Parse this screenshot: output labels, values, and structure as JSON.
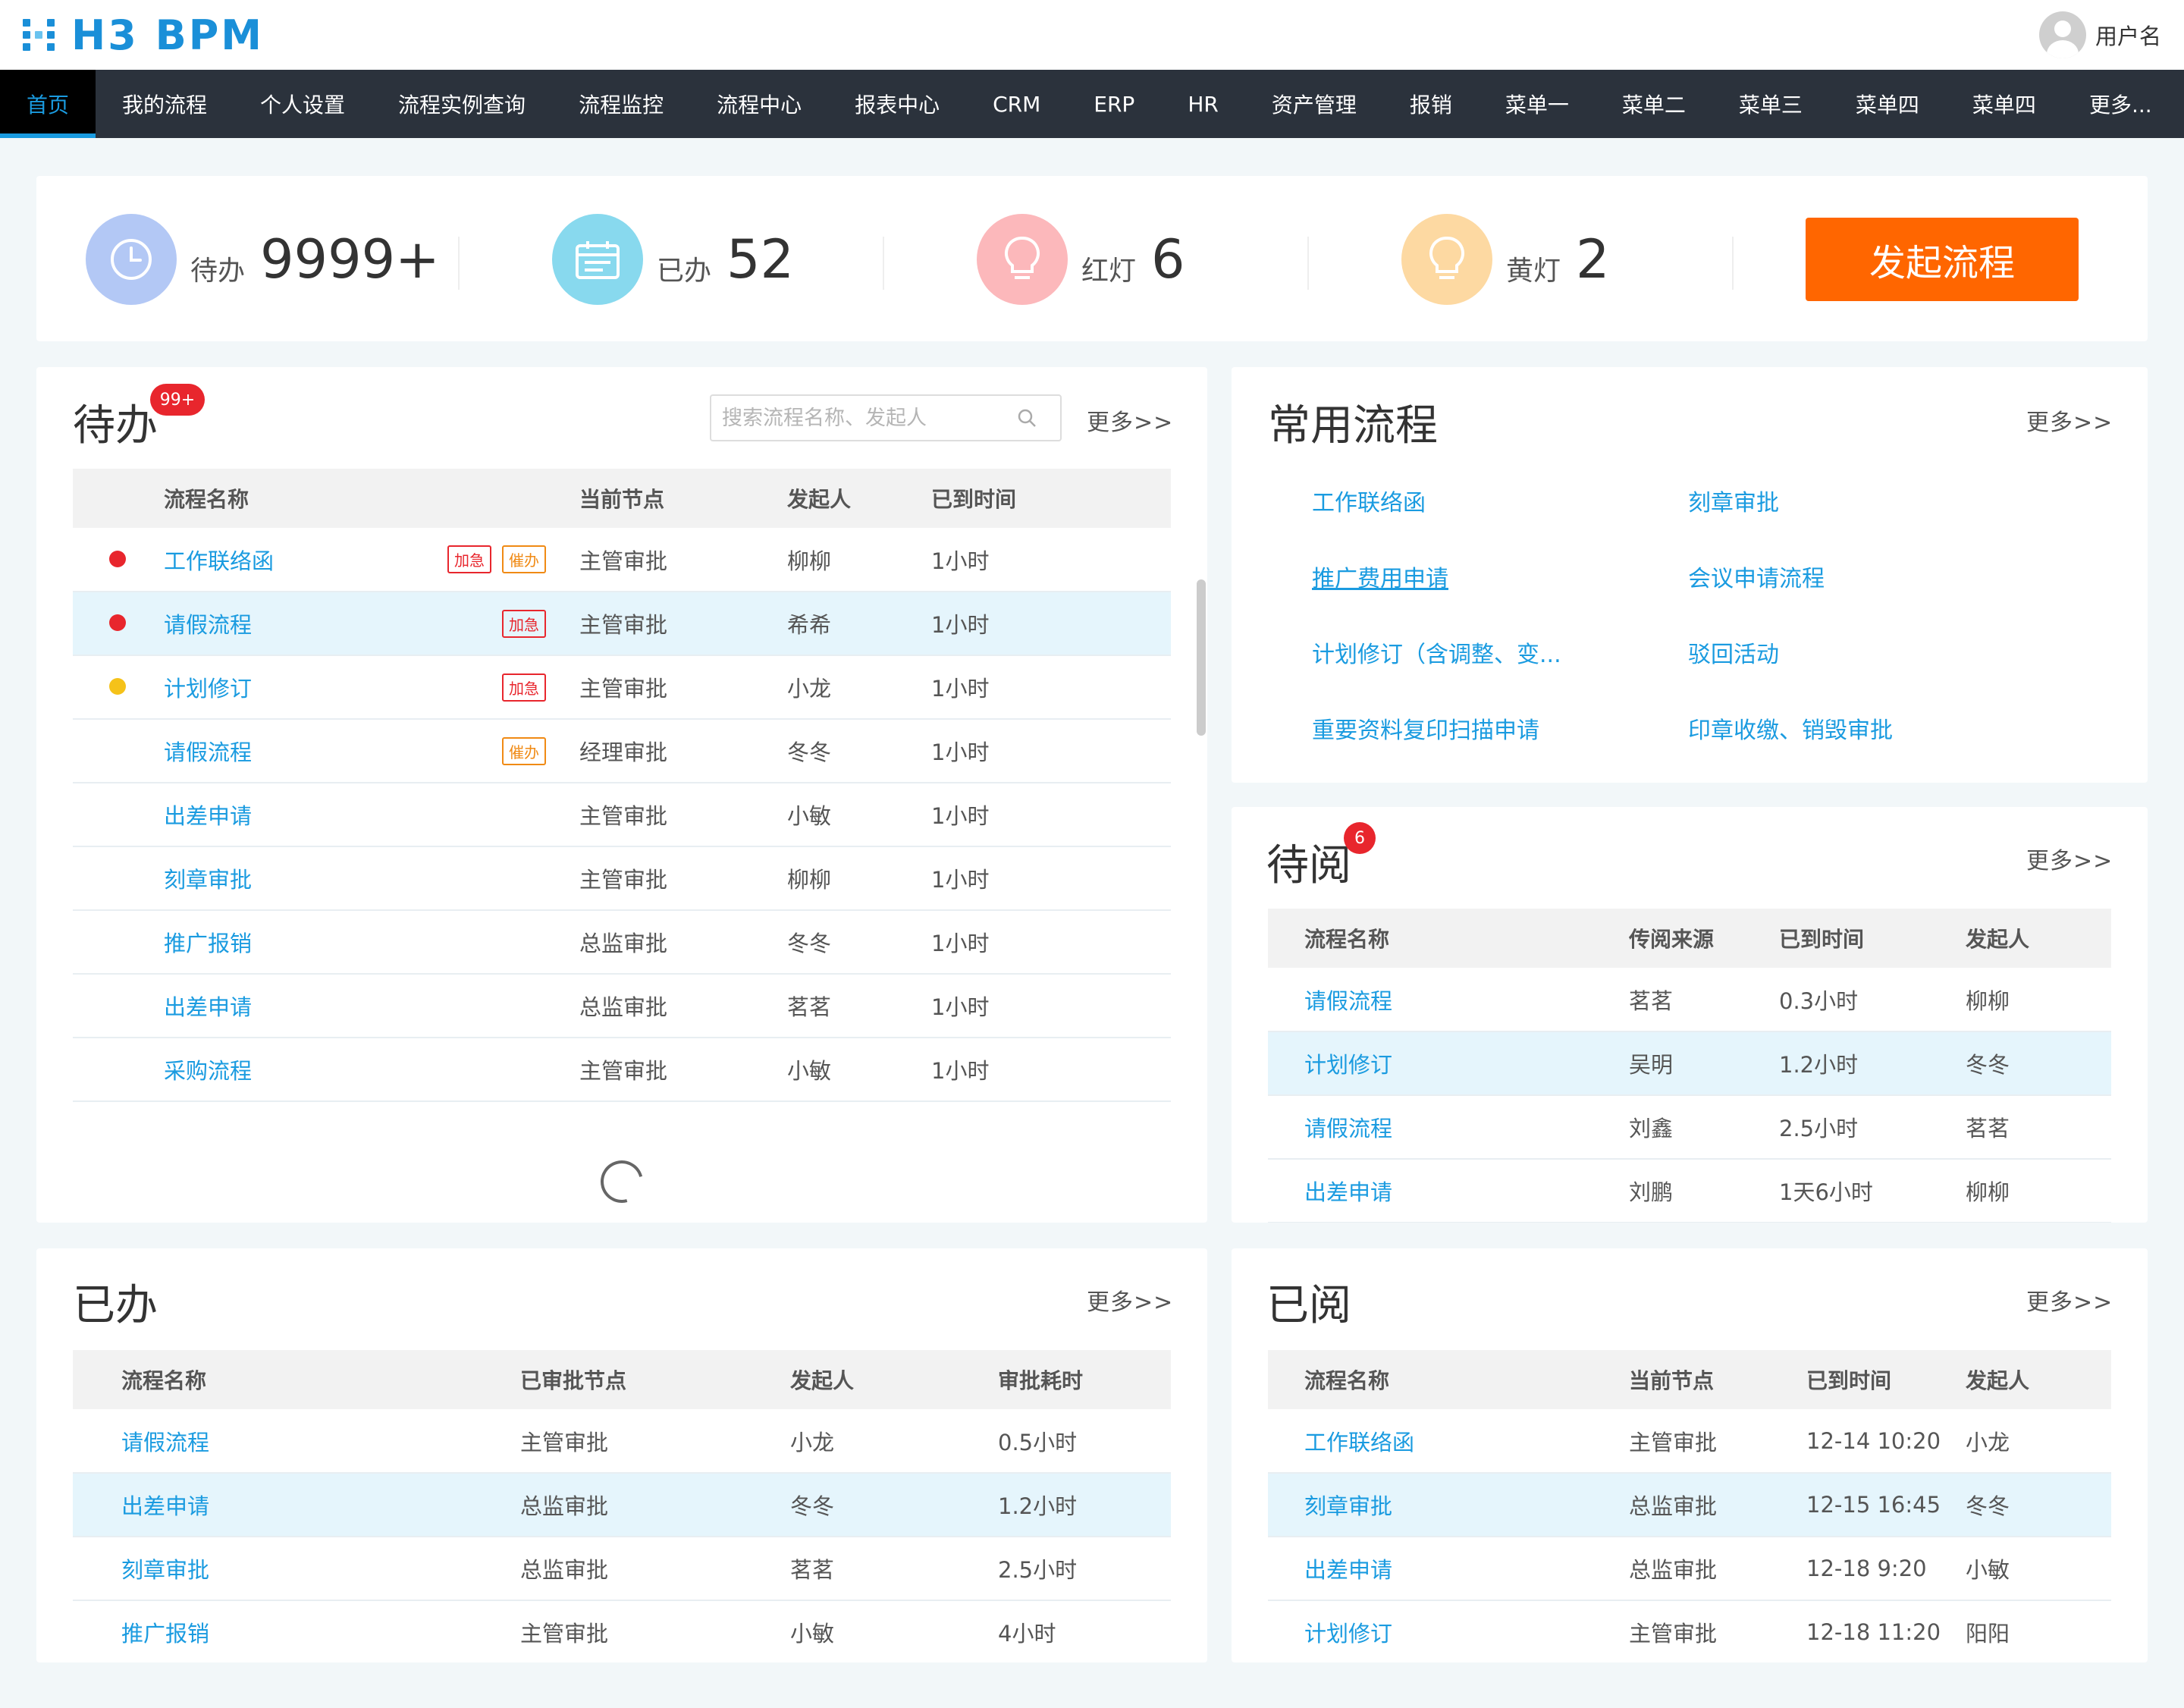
{
  "header": {
    "logo_text": "H3 BPM",
    "username": "用户名"
  },
  "nav": [
    {
      "label": "首页",
      "active": true
    },
    {
      "label": "我的流程"
    },
    {
      "label": "个人设置"
    },
    {
      "label": "流程实例查询"
    },
    {
      "label": "流程监控"
    },
    {
      "label": "流程中心"
    },
    {
      "label": "报表中心"
    },
    {
      "label": "CRM"
    },
    {
      "label": "ERP"
    },
    {
      "label": "HR"
    },
    {
      "label": "资产管理"
    },
    {
      "label": "报销"
    },
    {
      "label": "菜单一"
    },
    {
      "label": "菜单二"
    },
    {
      "label": "菜单三"
    },
    {
      "label": "菜单四"
    },
    {
      "label": "菜单四"
    },
    {
      "label": "更多..."
    }
  ],
  "summary": {
    "todo": {
      "label": "待办",
      "value": "9999+",
      "color": "#b3c8f5",
      "icon": "clock-icon"
    },
    "done": {
      "label": "已办",
      "value": "52",
      "color": "#88d9ee",
      "icon": "calendar-icon"
    },
    "red": {
      "label": "红灯",
      "value": "6",
      "color": "#fcb8bb",
      "icon": "bulb-icon"
    },
    "yellow": {
      "label": "黄灯",
      "value": "2",
      "color": "#fdd9a2",
      "icon": "bulb-icon"
    },
    "launch_label": "发起流程"
  },
  "todo_panel": {
    "title": "待办",
    "badge": "99+",
    "search_placeholder": "搜索流程名称、发起人",
    "more": "更多>>",
    "columns": [
      "流程名称",
      "当前节点",
      "发起人",
      "已到时间"
    ],
    "rows": [
      {
        "dot": "#e8262d",
        "name": "工作联络函",
        "tags": [
          "加急",
          "催办"
        ],
        "node": "主管审批",
        "initiator": "柳柳",
        "time": "1小时"
      },
      {
        "dot": "#e8262d",
        "name": "请假流程",
        "tags": [
          "加急"
        ],
        "node": "主管审批",
        "initiator": "希希",
        "time": "1小时",
        "highlight": true
      },
      {
        "dot": "#f5c219",
        "name": "计划修订",
        "tags": [
          "加急"
        ],
        "node": "主管审批",
        "initiator": "小龙",
        "time": "1小时"
      },
      {
        "dot": "",
        "name": "请假流程",
        "tags": [
          "催办"
        ],
        "node": "经理审批",
        "initiator": "冬冬",
        "time": "1小时"
      },
      {
        "dot": "",
        "name": "出差申请",
        "tags": [],
        "node": "主管审批",
        "initiator": "小敏",
        "time": "1小时"
      },
      {
        "dot": "",
        "name": "刻章审批",
        "tags": [],
        "node": "主管审批",
        "initiator": "柳柳",
        "time": "1小时"
      },
      {
        "dot": "",
        "name": "推广报销",
        "tags": [],
        "node": "总监审批",
        "initiator": "冬冬",
        "time": "1小时"
      },
      {
        "dot": "",
        "name": "出差申请",
        "tags": [],
        "node": "总监审批",
        "initiator": "茗茗",
        "time": "1小时"
      },
      {
        "dot": "",
        "name": "采购流程",
        "tags": [],
        "node": "主管审批",
        "initiator": "小敏",
        "time": "1小时"
      }
    ]
  },
  "common_panel": {
    "title": "常用流程",
    "more": "更多>>",
    "items": [
      "工作联络函",
      "刻章审批",
      "推广费用申请",
      "会议申请流程",
      "计划修订（含调整、变...",
      "驳回活动",
      "重要资料复印扫描申请",
      "印章收缴、销毁审批"
    ]
  },
  "toread_panel": {
    "title": "待阅",
    "badge": "6",
    "more": "更多>>",
    "columns": [
      "流程名称",
      "传阅来源",
      "已到时间",
      "发起人"
    ],
    "rows": [
      {
        "name": "请假流程",
        "source": "茗茗",
        "time": "0.3小时",
        "initiator": "柳柳"
      },
      {
        "name": "计划修订",
        "source": "吴明",
        "time": "1.2小时",
        "initiator": "冬冬",
        "highlight": true
      },
      {
        "name": "请假流程",
        "source": "刘鑫",
        "time": "2.5小时",
        "initiator": "茗茗"
      },
      {
        "name": "出差申请",
        "source": "刘鹏",
        "time": "1天6小时",
        "initiator": "柳柳"
      }
    ]
  },
  "done_panel": {
    "title": "已办",
    "more": "更多>>",
    "columns": [
      "流程名称",
      "已审批节点",
      "发起人",
      "审批耗时"
    ],
    "rows": [
      {
        "name": "请假流程",
        "node": "主管审批",
        "initiator": "小龙",
        "time": "0.5小时"
      },
      {
        "name": "出差申请",
        "node": "总监审批",
        "initiator": "冬冬",
        "time": "1.2小时",
        "highlight": true
      },
      {
        "name": "刻章审批",
        "node": "总监审批",
        "initiator": "茗茗",
        "time": "2.5小时"
      },
      {
        "name": "推广报销",
        "node": "主管审批",
        "initiator": "小敏",
        "time": "4小时"
      }
    ]
  },
  "read_panel": {
    "title": "已阅",
    "more": "更多>>",
    "columns": [
      "流程名称",
      "当前节点",
      "已到时间",
      "发起人"
    ],
    "rows": [
      {
        "name": "工作联络函",
        "node": "主管审批",
        "time": "12-14 10:20",
        "initiator": "小龙"
      },
      {
        "name": "刻章审批",
        "node": "总监审批",
        "time": "12-15 16:45",
        "initiator": "冬冬",
        "highlight": true
      },
      {
        "name": "出差申请",
        "node": "总监审批",
        "time": "12-18 9:20",
        "initiator": "小敏"
      },
      {
        "name": "计划修订",
        "node": "主管审批",
        "time": "12-18 11:20",
        "initiator": "阳阳"
      }
    ]
  }
}
